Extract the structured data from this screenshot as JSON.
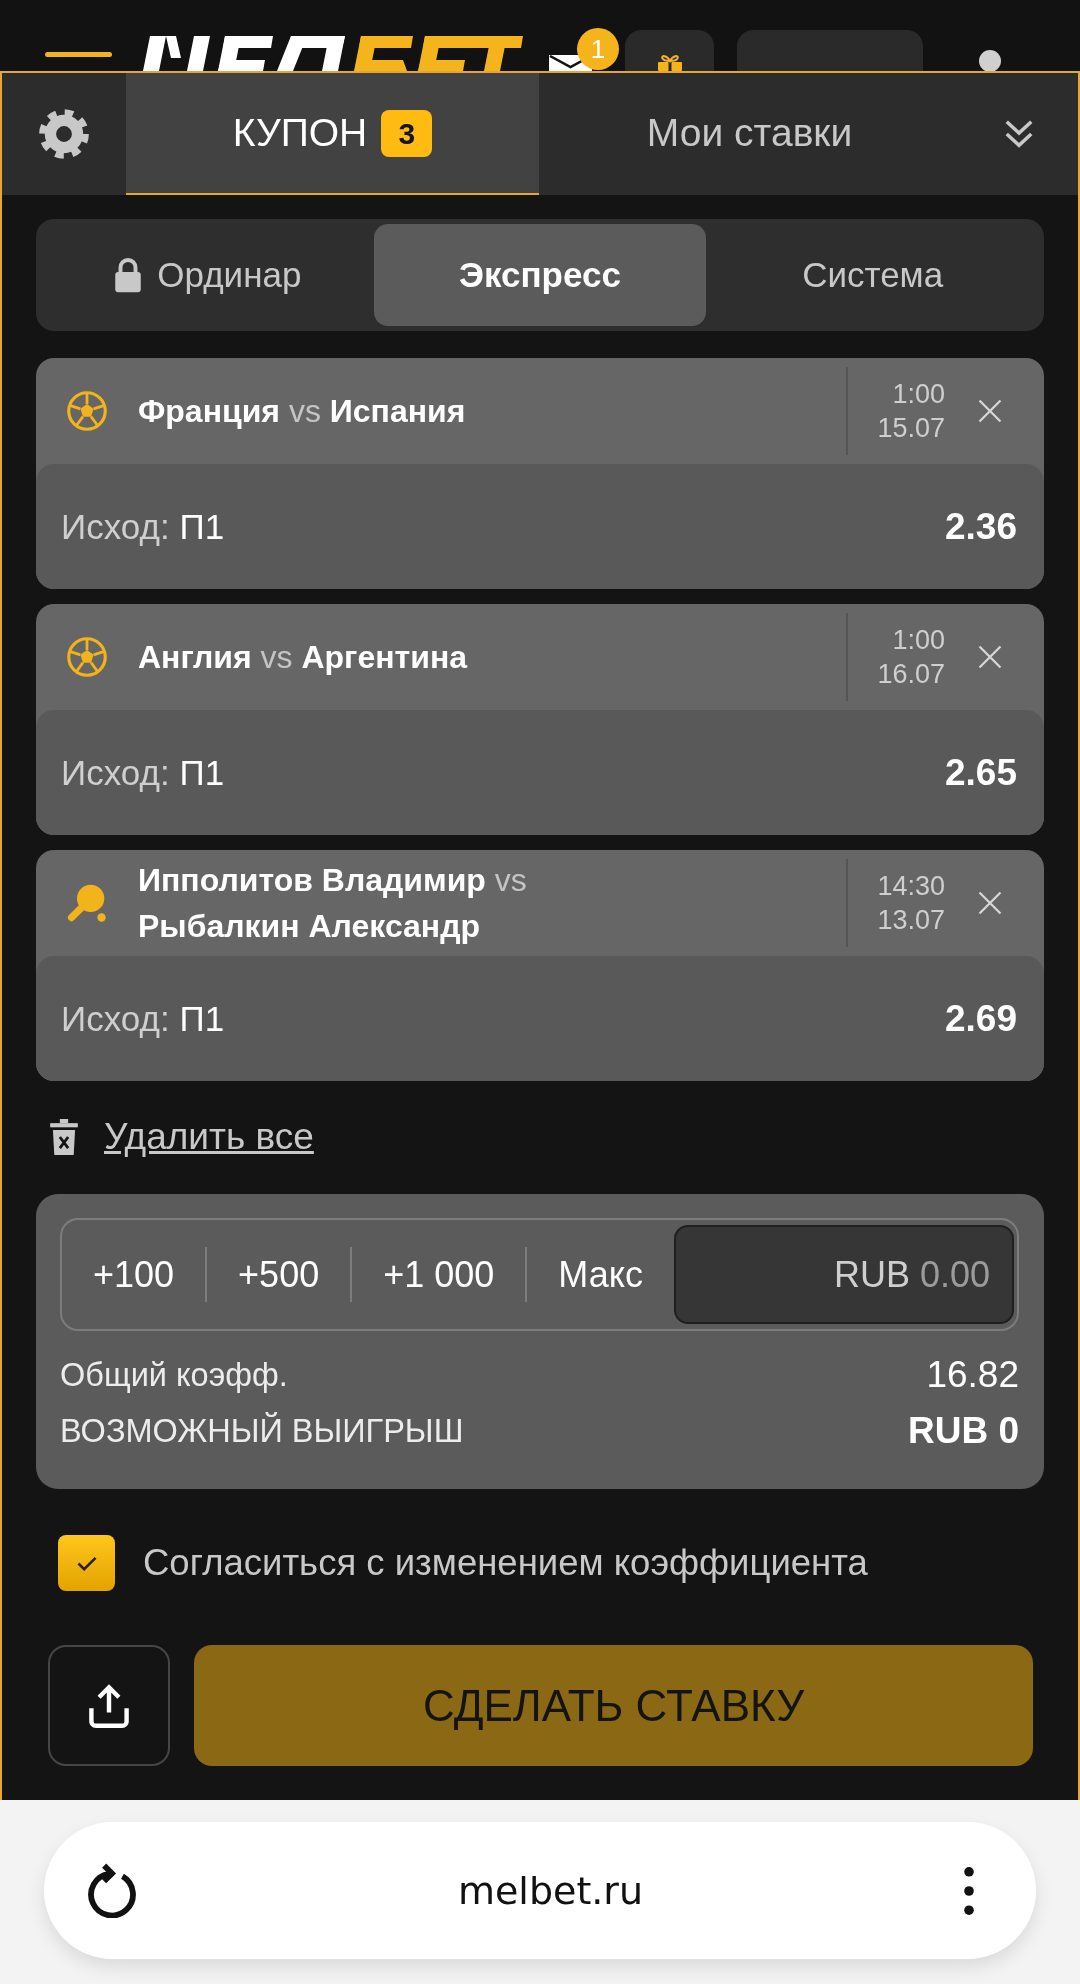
{
  "header": {
    "mail_badge": "1"
  },
  "coupon_tabs": [
    {
      "label": "КУПОН",
      "count": "3",
      "selected": true
    },
    {
      "label": "Мои ставки",
      "selected": false
    }
  ],
  "bet_types": [
    {
      "label": "Ординар",
      "locked": true,
      "selected": false
    },
    {
      "label": "Экспресс",
      "locked": false,
      "selected": true
    },
    {
      "label": "Система",
      "locked": false,
      "selected": false
    }
  ],
  "bets": [
    {
      "kind": "football",
      "match": "**Франция** vs **Испания**",
      "time": "1:00",
      "date": "15.07",
      "outcome_label": "Исход:",
      "outcome": "П1",
      "odds": "2.36"
    },
    {
      "kind": "football",
      "match": "**Англия** vs **Аргентина**",
      "time": "1:00",
      "date": "16.07",
      "outcome_label": "Исход:",
      "outcome": "П1",
      "odds": "2.65"
    },
    {
      "kind": "table_tennis",
      "match": "**Ипполитов Владимир** vs **Рыбалкин Александр**",
      "time": "14:30",
      "date": "13.07",
      "outcome_label": "Исход:",
      "outcome": "П1",
      "odds": "2.69"
    }
  ],
  "delete_all": "Удалить все",
  "stake": {
    "quick_amounts": [
      "+100",
      "+500",
      "+1 000",
      "Макс"
    ],
    "currency": "RUB",
    "placeholder": "0.00",
    "total_odds_label": "Общий коэфф.",
    "total_odds": "16.82",
    "payout_label": "ВОЗМОЖНЫЙ ВЫИГРЫШ",
    "payout": "RUB 0"
  },
  "accept_changes": {
    "label": "Согласиться с изменением коэффициента",
    "checked": true
  },
  "place_bet": "СДЕЛАТЬ СТАВКУ",
  "browser": {
    "url": "melbet.ru"
  }
}
